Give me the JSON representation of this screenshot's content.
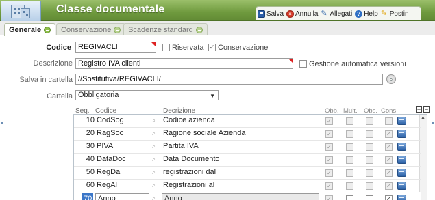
{
  "header": {
    "title": "Classe documentale",
    "toolbar": [
      {
        "label": "Salva",
        "icon": "save-icon"
      },
      {
        "label": "Annulla",
        "icon": "cancel-icon"
      },
      {
        "label": "Allegati",
        "icon": "attachment-icon"
      },
      {
        "label": "Help",
        "icon": "help-icon"
      },
      {
        "label": "Postin",
        "icon": "postit-icon"
      }
    ]
  },
  "tabs": [
    {
      "label": "Generale",
      "active": true
    },
    {
      "label": "Conservazione",
      "active": false
    },
    {
      "label": "Scadenze standard",
      "active": false
    }
  ],
  "form": {
    "codice_label": "Codice",
    "codice_value": "REGIVACLI",
    "riservata_label": "Riservata",
    "riservata_checked": false,
    "conservazione_label": "Conservazione",
    "conservazione_checked": true,
    "descrizione_label": "Descrizione",
    "descrizione_value": "Registro IVA clienti",
    "gestione_label": "Gestione automatica versioni",
    "gestione_checked": false,
    "salva_label": "Salva in cartella",
    "salva_value": "//Sostitutiva/REGIVACLI/",
    "cartella_label": "Cartella",
    "cartella_value": "Obbligatoria"
  },
  "grid": {
    "headers": {
      "seq": "Seq.",
      "codice": "Codice",
      "decrizione": "Decrizione",
      "obb": "Obb.",
      "mult": "Mult.",
      "obs": "Obs.",
      "cons": "Cons."
    },
    "rows": [
      {
        "seq": "10",
        "codice": "CodSog",
        "descr": "Codice azienda",
        "obb": true,
        "mult": false,
        "obs": false,
        "cons": false
      },
      {
        "seq": "20",
        "codice": "RagSoc",
        "descr": "Ragione sociale Azienda",
        "obb": true,
        "mult": false,
        "obs": false,
        "cons": true
      },
      {
        "seq": "30",
        "codice": "PIVA",
        "descr": "Partita IVA",
        "obb": true,
        "mult": false,
        "obs": false,
        "cons": true
      },
      {
        "seq": "40",
        "codice": "DataDoc",
        "descr": "Data Documento",
        "obb": true,
        "mult": false,
        "obs": false,
        "cons": true
      },
      {
        "seq": "50",
        "codice": "RegDal",
        "descr": "registrazioni dal",
        "obb": true,
        "mult": false,
        "obs": false,
        "cons": true
      },
      {
        "seq": "60",
        "codice": "RegAl",
        "descr": "Registrazioni al",
        "obb": true,
        "mult": false,
        "obs": false,
        "cons": true
      },
      {
        "seq": "70",
        "codice": "Anno",
        "descr": "Anno",
        "obb": true,
        "mult": false,
        "obs": false,
        "cons": true
      }
    ],
    "plus": "+",
    "minus": "−"
  },
  "colors": {
    "header_green": "#6f9a3e",
    "selection_blue": "#3a76c8",
    "required_red": "#d22222"
  }
}
